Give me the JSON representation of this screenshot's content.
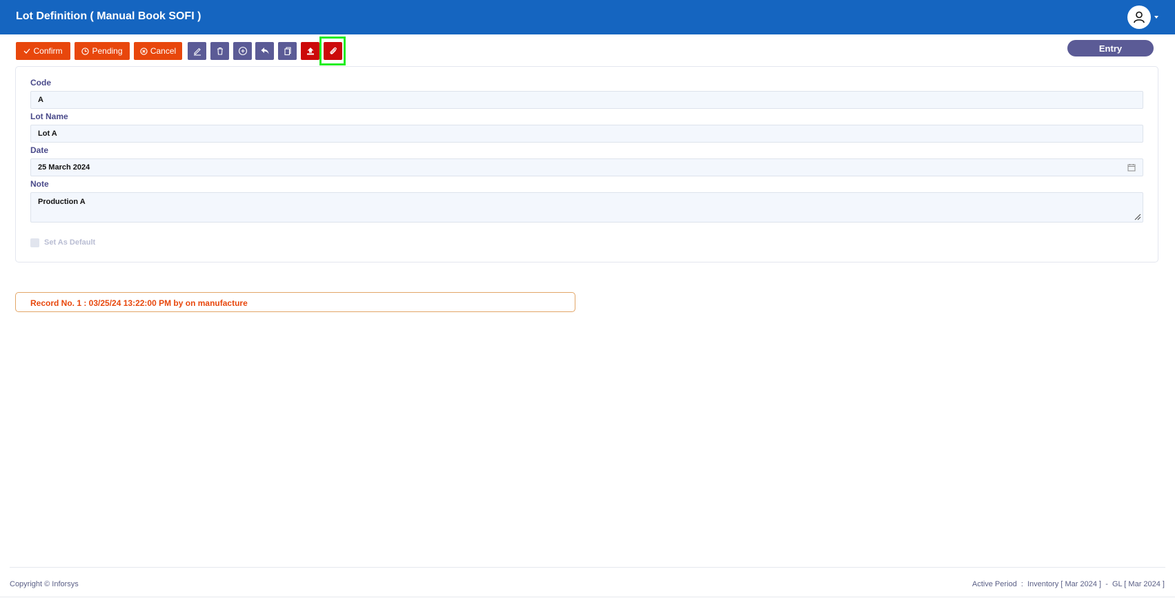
{
  "header": {
    "title": "Lot Definition ( Manual Book SOFI )",
    "user_icon": "user-icon"
  },
  "toolbar": {
    "confirm_label": "Confirm",
    "pending_label": "Pending",
    "cancel_label": "Cancel",
    "icon_buttons": [
      "edit-icon",
      "trash-icon",
      "plus-circle-icon",
      "undo-icon",
      "copy-icon",
      "upload-icon",
      "paperclip-icon"
    ],
    "highlighted": "paperclip-icon"
  },
  "status_badge": "Entry",
  "form": {
    "code_label": "Code",
    "code_value": "A",
    "lot_name_label": "Lot Name",
    "lot_name_value": "Lot A",
    "date_label": "Date",
    "date_value": "25 March 2024",
    "note_label": "Note",
    "note_value": "Production A",
    "default_label": "Set As Default",
    "default_checked": false
  },
  "record_info": "Record No. 1 : 03/25/24 13:22:00 PM by on manufacture",
  "footer": {
    "copyright": "Copyright © Inforsys",
    "active_period": "Active Period  :  Inventory [ Mar 2024 ]  -  GL [ Mar 2024 ]"
  },
  "colors": {
    "header": "#1565c0",
    "primary_action": "#e8470c",
    "secondary_action": "#5b5b96",
    "danger_action": "#cc0a0a",
    "highlight": "#22ee22"
  }
}
